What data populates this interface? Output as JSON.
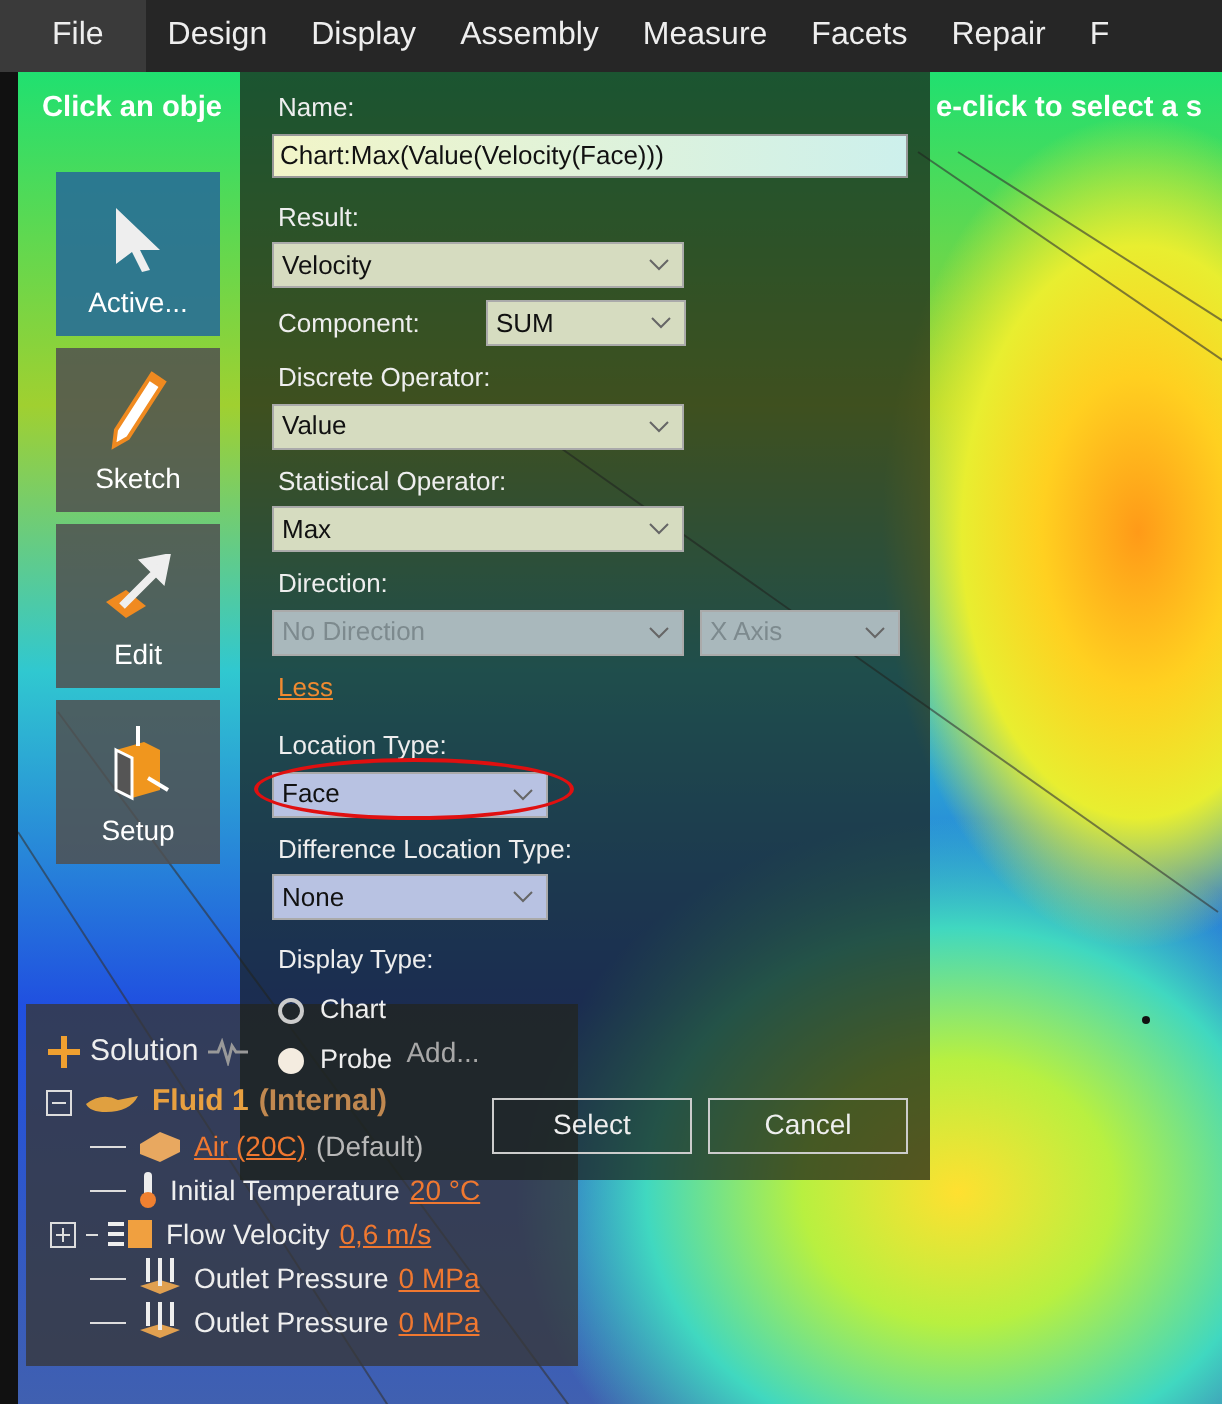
{
  "menu": [
    {
      "label": "File",
      "selected": true
    },
    {
      "label": "Design",
      "selected": false
    },
    {
      "label": "Display",
      "selected": false
    },
    {
      "label": "Assembly",
      "selected": false
    },
    {
      "label": "Measure",
      "selected": false
    },
    {
      "label": "Facets",
      "selected": false
    },
    {
      "label": "Repair",
      "selected": false
    },
    {
      "label": "F",
      "selected": false
    }
  ],
  "hint": [
    "Click an obje",
    "e-click to select a s"
  ],
  "tools": [
    {
      "label": "Active...",
      "kind": "select",
      "selected": true
    },
    {
      "label": "Sketch",
      "kind": "sketch",
      "selected": false
    },
    {
      "label": "Edit",
      "kind": "edit",
      "selected": false
    },
    {
      "label": "Setup",
      "kind": "setup",
      "selected": false
    }
  ],
  "dialog": {
    "name_label": "Name:",
    "name_value": "Chart:Max(Value(Velocity(Face)))",
    "fields": [
      {
        "kind": "dropdown",
        "label": "Result:",
        "value": "Velocity",
        "disabled": false,
        "highlighted": false
      },
      {
        "kind": "inline",
        "label": "Component:",
        "value": "SUM",
        "disabled": false,
        "highlighted": false
      },
      {
        "kind": "dropdown",
        "label": "Discrete Operator:",
        "value": "Value",
        "disabled": false,
        "highlighted": false
      },
      {
        "kind": "dropdown",
        "label": "Statistical Operator:",
        "value": "Max",
        "disabled": false,
        "highlighted": false
      },
      {
        "kind": "pair",
        "label": "Direction:",
        "value": "No Direction",
        "value_2": "X Axis",
        "disabled": true,
        "highlighted": false
      },
      {
        "kind": "link",
        "label": "Less"
      },
      {
        "kind": "dropdown",
        "label": "Location Type:",
        "value": "Face",
        "disabled": false,
        "highlighted": true
      },
      {
        "kind": "dropdown",
        "label": "Difference Location Type:",
        "value": "None",
        "disabled": false,
        "highlighted": false
      }
    ],
    "display_type": {
      "label": "Display Type:",
      "options": [
        {
          "label": "Chart",
          "selected": false
        },
        {
          "label": "Probe",
          "selected": true
        }
      ]
    },
    "buttons": [
      "Select",
      "Cancel"
    ]
  },
  "tree": {
    "toolbar": {
      "add_label": "Solution",
      "menu_label": "Add...",
      "menu_disabled": true
    },
    "root": {
      "label": "Fluid 1",
      "note": "(Internal)",
      "expanded": true,
      "children": [
        {
          "kind": "material",
          "value": "Air (20C)",
          "note": "(Default)"
        },
        {
          "kind": "temperature",
          "label": "Initial Temperature",
          "value": "20 °C"
        },
        {
          "kind": "velocity",
          "label": "Flow Velocity",
          "value": "0,6 m/s",
          "expanded": false
        },
        {
          "kind": "pressure",
          "label": "Outlet Pressure",
          "value": "0 MPa"
        },
        {
          "kind": "pressure",
          "label": "Outlet Pressure",
          "value": "0 MPa"
        }
      ]
    }
  }
}
